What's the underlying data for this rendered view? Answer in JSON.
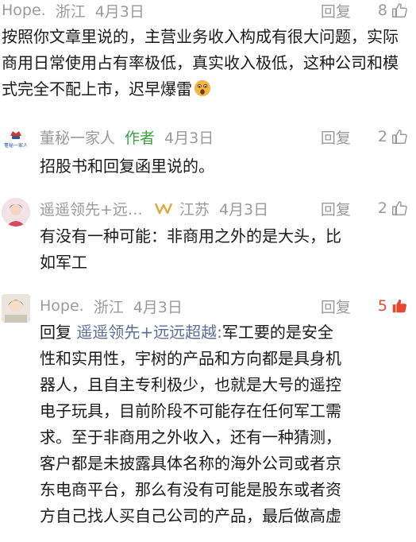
{
  "comments": [
    {
      "user": "Hope.",
      "location": "浙江",
      "date": "4月3日",
      "reply_label": "回复",
      "likes": "8",
      "text": "按照你文章里说的，主营业务收入构成有很大问题，实际商用日常使用占有率极低，真实收入极低，这种公司和模式完全不配上市，迟早爆雷"
    },
    {
      "user": "董秘一家人",
      "author_tag": "作者",
      "date": "4月3日",
      "reply_label": "回复",
      "likes": "2",
      "avatar_label": "董秘一家人",
      "text": "招股书和回复函里说的。"
    },
    {
      "user": "遥遥领先+远…",
      "location": "江苏",
      "date": "4月3日",
      "reply_label": "回复",
      "likes": "2",
      "text_line1": "有没有一种可能：非商用之外的是大头，比",
      "text_line2": "如军工"
    },
    {
      "user": "Hope.",
      "location": "浙江",
      "date": "4月3日",
      "reply_label": "回复",
      "likes": "5",
      "reply_prefix": "回复",
      "mention": "遥遥领先+远远超越:",
      "lines": [
        "军工要的是安全",
        "性和实用性，宇树的产品和方向都是具身机",
        "器人，且自主专利极少，也就是大号的遥控",
        "电子玩具，目前阶段不可能存在任何军工需",
        "求。至于非商用之外收入，还有一种猜测，",
        "客户都是未披露具体名称的海外公司或者京",
        "东电商平台，那么有没有可能是股东或者资",
        "方自己找人买自己公司的产品，最后做高虚"
      ]
    }
  ],
  "colors": {
    "meta": "#9a9a9a",
    "author_tag": "#3aa13f",
    "mention": "#5c6f9a",
    "hot_like": "#e6492d"
  },
  "icons": {
    "like": "thumbs-up-icon",
    "emoji": "surprised-face-emoji"
  }
}
